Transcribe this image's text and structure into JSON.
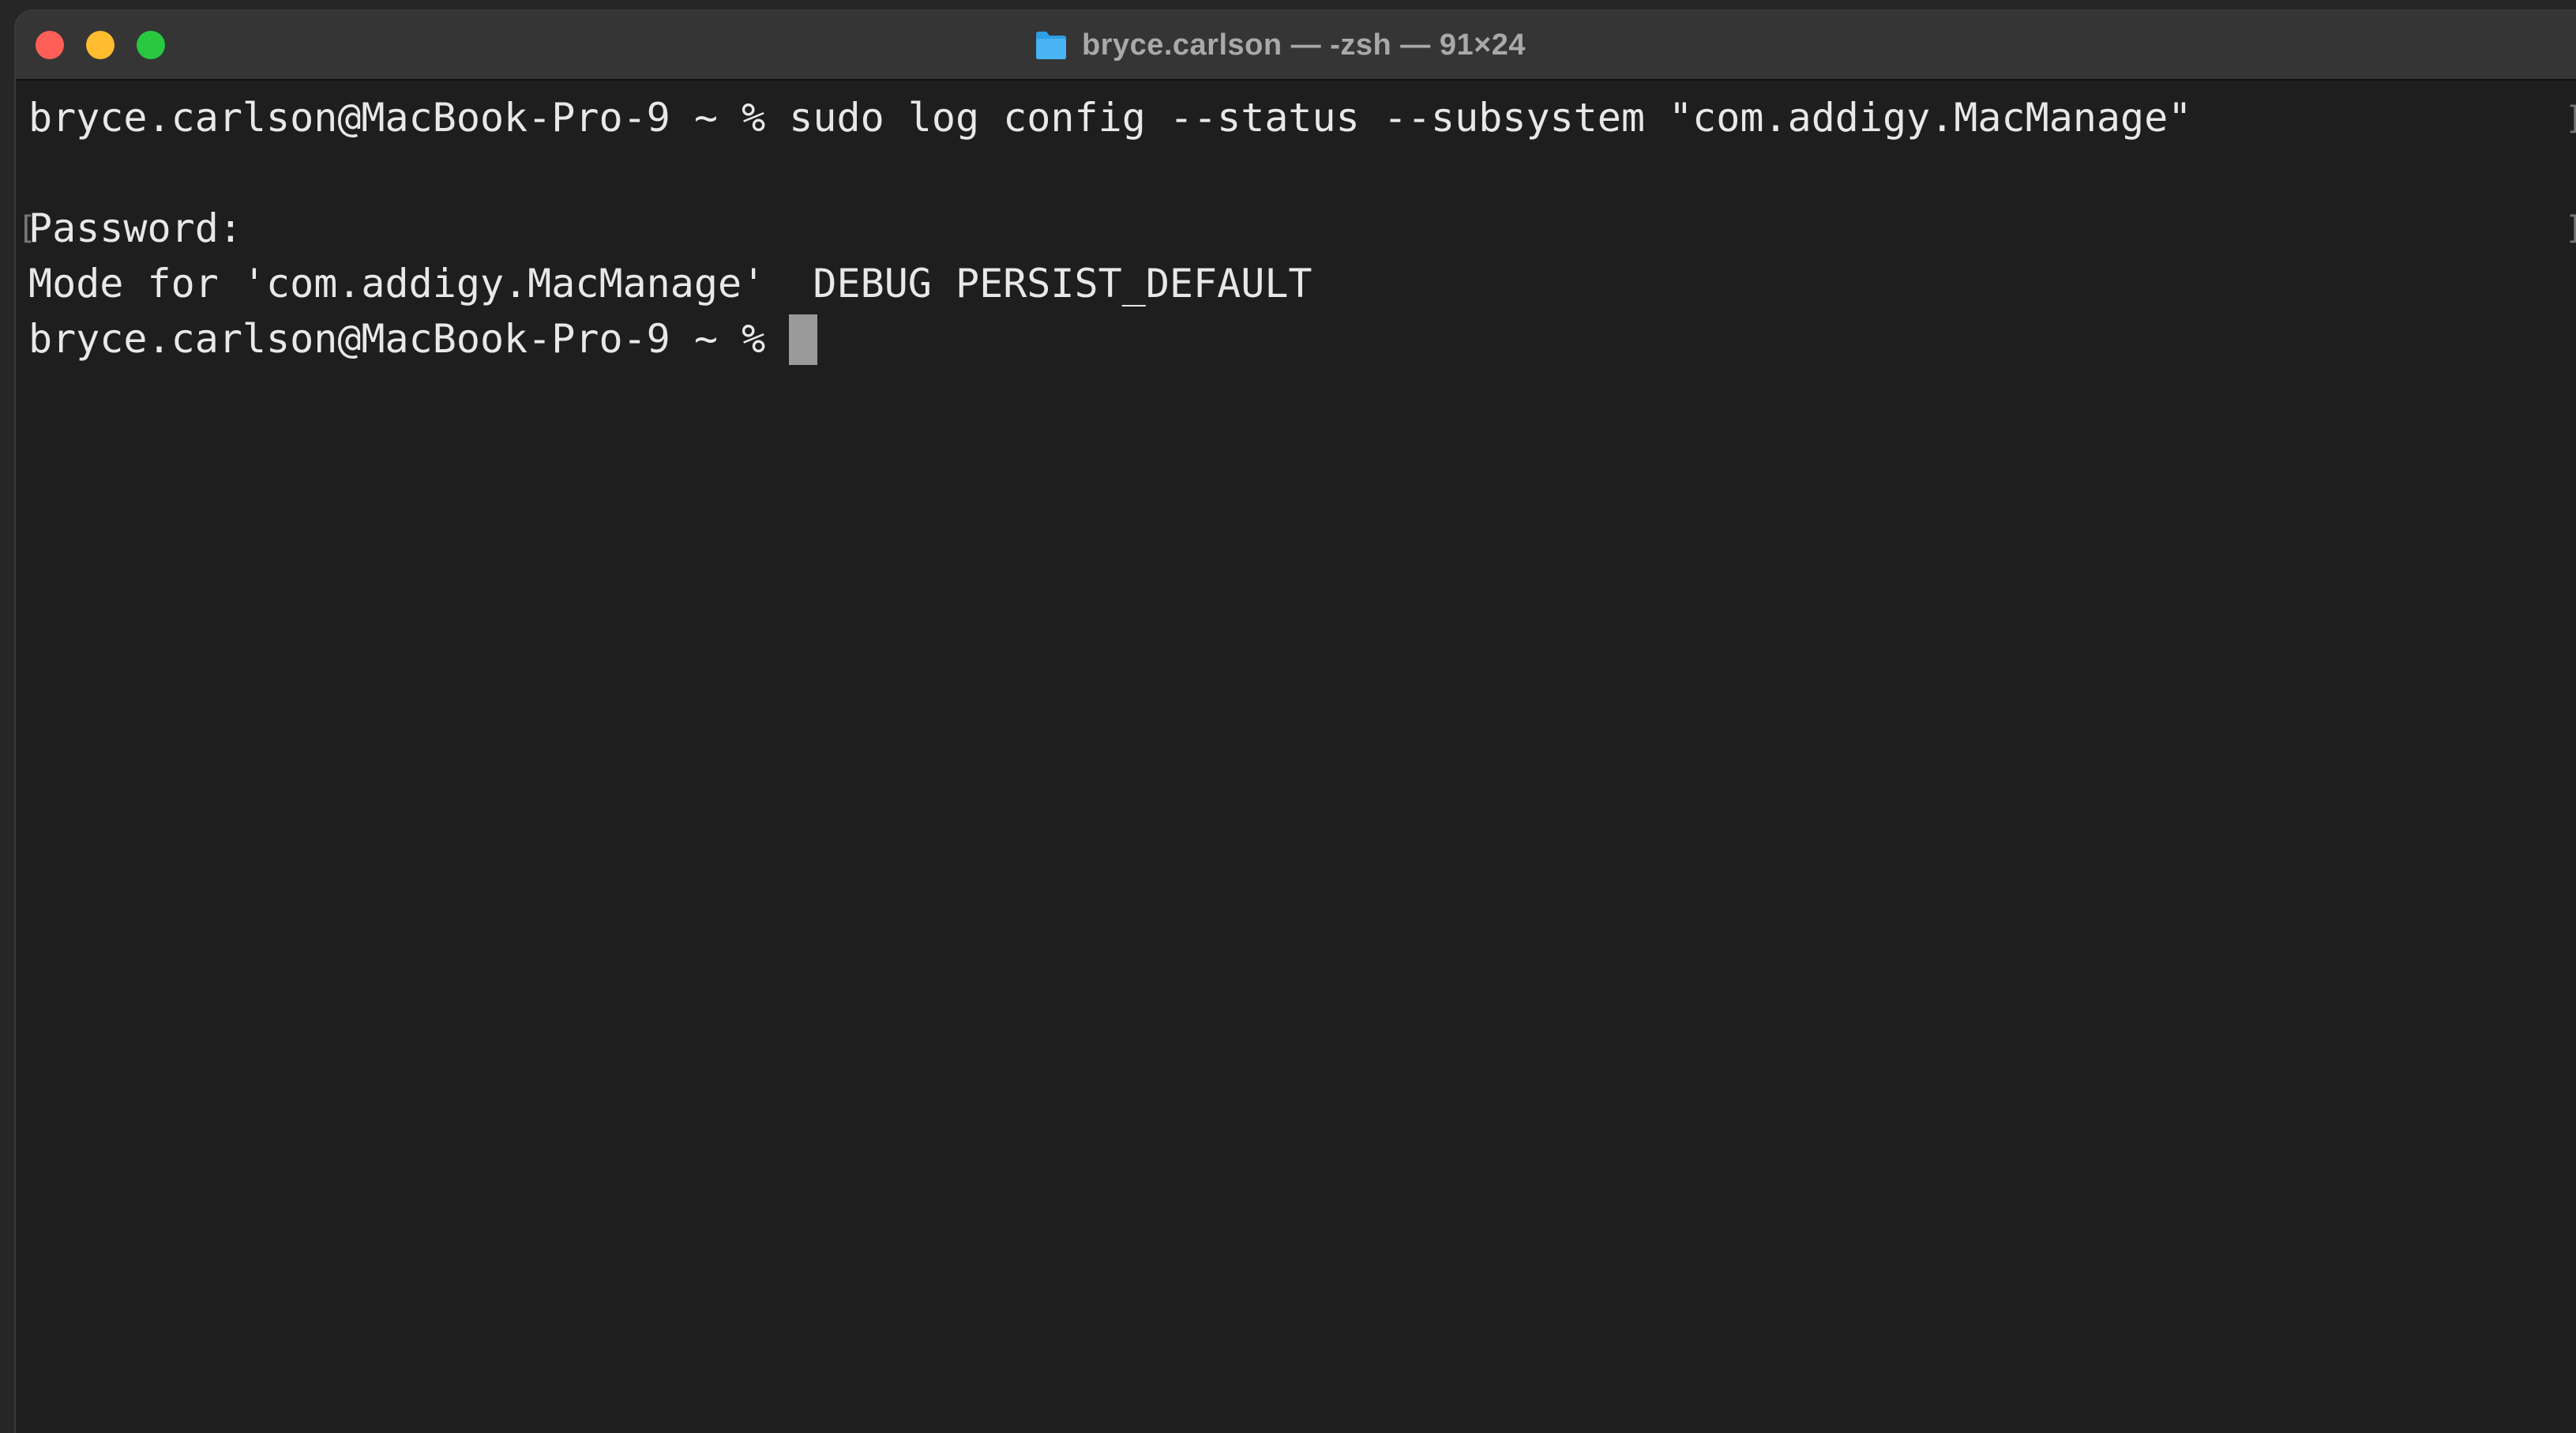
{
  "window": {
    "title": "bryce.carlson — -zsh — 91×24",
    "traffic_lights": {
      "close_color": "#ff5f57",
      "minimize_color": "#febc2e",
      "zoom_color": "#28c840"
    },
    "folder_icon": "folder-icon"
  },
  "terminal": {
    "lines": [
      "bryce.carlson@MacBook-Pro-9 ~ % sudo log config --status --subsystem \"com.addigy.MacManage\"",
      "Password:",
      "Mode for 'com.addigy.MacManage'  DEBUG PERSIST_DEFAULT",
      "bryce.carlson@MacBook-Pro-9 ~ % "
    ],
    "brackets": {
      "open": "[",
      "close": "]"
    }
  }
}
